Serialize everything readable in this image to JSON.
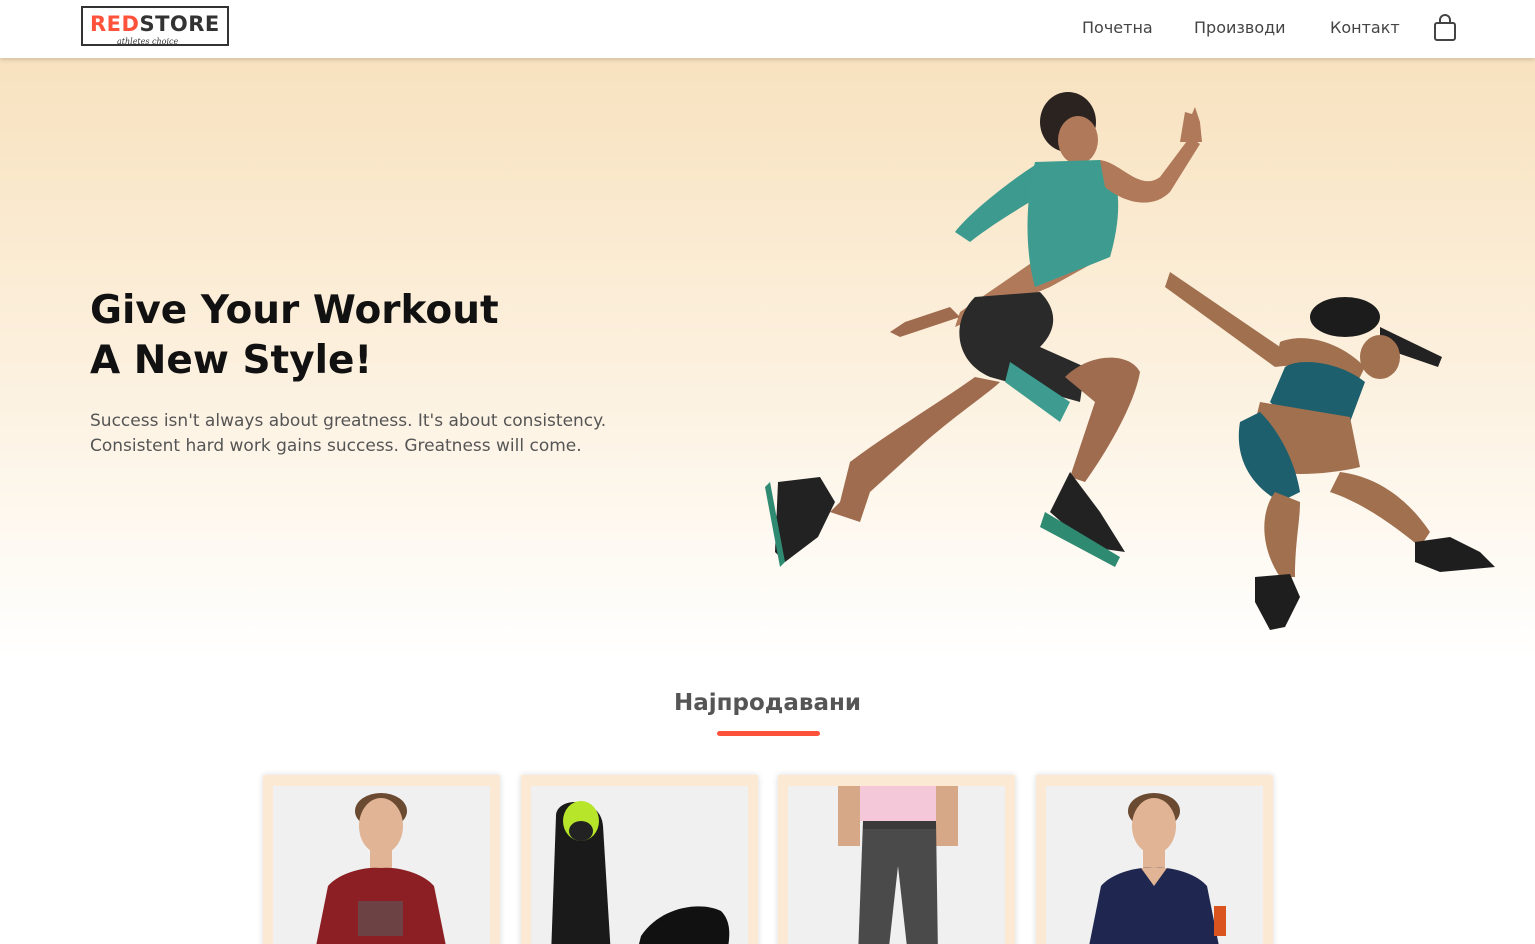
{
  "header": {
    "logo": {
      "brand_red": "RED",
      "brand_dark": "STORE",
      "tagline": "athletes choice"
    },
    "nav": [
      {
        "label": "Почетна"
      },
      {
        "label": "Производи"
      },
      {
        "label": "Контакт"
      }
    ],
    "cart_icon": "shopping-bag-icon"
  },
  "hero": {
    "title_line1": "Give Your Workout",
    "title_line2": "A New Style!",
    "text_line1": "Success isn't always about greatness. It's about consistency.",
    "text_line2": "Consistent hard work gains success. Greatness will come."
  },
  "featured": {
    "title": "Најпродавани",
    "products": [
      {
        "image": "red-tshirt-model"
      },
      {
        "image": "black-sneakers"
      },
      {
        "image": "grey-joggers"
      },
      {
        "image": "navy-polo-model"
      }
    ]
  },
  "colors": {
    "accent": "#ff523b",
    "hero_top": "#f8e2bf",
    "card_bg": "#fbe9d3"
  }
}
